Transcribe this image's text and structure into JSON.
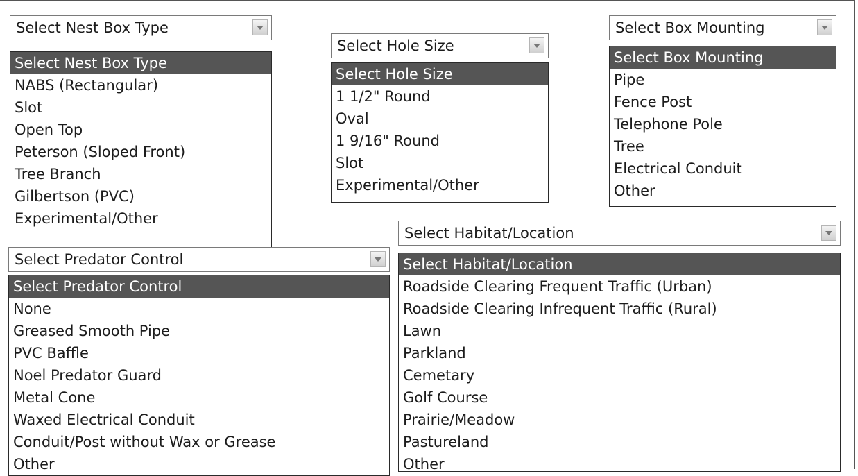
{
  "nest_box": {
    "selected": "Select Nest Box Type",
    "options": [
      "Select Nest Box Type",
      "NABS (Rectangular)",
      "Slot",
      "Open Top",
      "Peterson (Sloped Front)",
      "Tree Branch",
      "Gilbertson (PVC)",
      "Experimental/Other"
    ]
  },
  "hole_size": {
    "selected": "Select Hole Size",
    "options": [
      "Select Hole Size",
      "1 1/2\" Round",
      "Oval",
      "1 9/16\" Round",
      "Slot",
      "Experimental/Other"
    ]
  },
  "box_mounting": {
    "selected": "Select Box Mounting",
    "options": [
      "Select Box Mounting",
      "Pipe",
      "Fence Post",
      "Telephone Pole",
      "Tree",
      "Electrical Conduit",
      "Other"
    ]
  },
  "predator_control": {
    "selected": "Select Predator Control",
    "options": [
      "Select Predator Control",
      "None",
      "Greased Smooth Pipe",
      "PVC Baffle",
      "Noel Predator Guard",
      "Metal Cone",
      "Waxed Electrical Conduit",
      "Conduit/Post without Wax or Grease",
      "Other"
    ]
  },
  "habitat": {
    "selected": "Select Habitat/Location",
    "options": [
      "Select Habitat/Location",
      "Roadside Clearing Frequent Traffic (Urban)",
      "Roadside Clearing Infrequent Traffic (Rural)",
      "Lawn",
      "Parkland",
      "Cemetary",
      "Golf Course",
      "Prairie/Meadow",
      "Pastureland",
      "Other"
    ]
  },
  "icons": {
    "dropdown_arrow": "chevron-down-icon"
  },
  "colors": {
    "highlight": "#555555",
    "highlight_text": "#ffffff",
    "border": "#2a2a2a"
  }
}
